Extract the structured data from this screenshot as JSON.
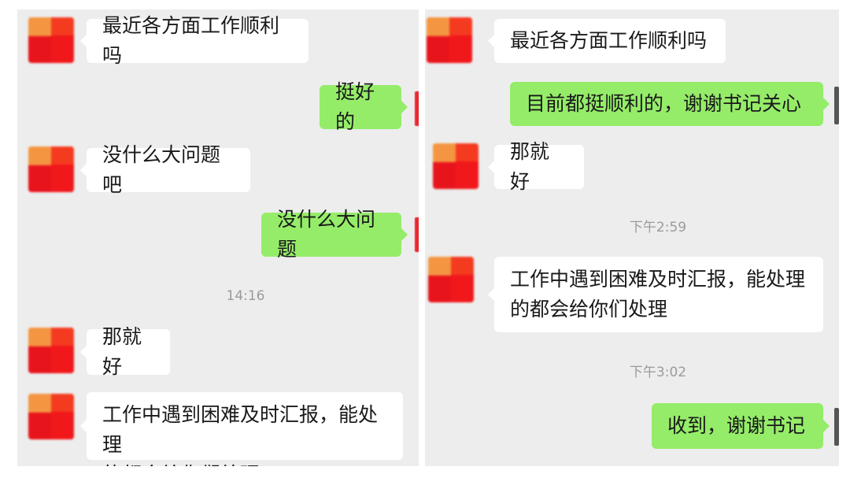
{
  "left_chat": {
    "messages": [
      {
        "side": "in",
        "text": "最近各方面工作顺利吗"
      },
      {
        "side": "out",
        "text": "挺好的"
      },
      {
        "side": "in",
        "text": "没什么大问题吧"
      },
      {
        "side": "out",
        "text": "没什么大问题"
      },
      {
        "side": "in",
        "text": "那就好"
      },
      {
        "side": "in",
        "text": "工作中遇到困难及时汇报，能处理\n的都会给你们处理"
      }
    ],
    "timestamp": "14:16"
  },
  "right_chat": {
    "messages": [
      {
        "side": "in",
        "text": "最近各方面工作顺利吗"
      },
      {
        "side": "out",
        "text": "目前都挺顺利的，谢谢书记关心"
      },
      {
        "side": "in",
        "text": "那就好"
      },
      {
        "side": "in",
        "text": "工作中遇到困难及时汇报，能处理\n的都会给你们处理"
      },
      {
        "side": "out",
        "text": "收到，谢谢书记"
      }
    ],
    "timestamps": [
      "下午2:59",
      "下午3:02"
    ]
  },
  "colors": {
    "background": "#ededed",
    "incoming_bubble": "#ffffff",
    "outgoing_bubble": "#95ec69",
    "avatar": "#e8141c"
  }
}
